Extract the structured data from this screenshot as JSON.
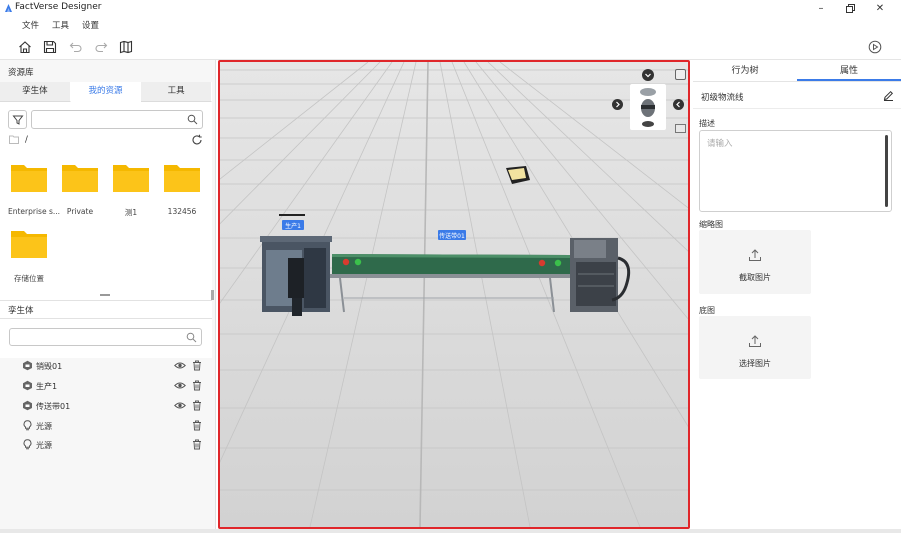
{
  "app": {
    "title": "FactVerse Designer"
  },
  "menu": [
    "文件",
    "工具",
    "设置"
  ],
  "left": {
    "library_title": "资源库",
    "tabs": [
      "孪生体",
      "我的资源",
      "工具"
    ],
    "active_tab": 1,
    "path": "/",
    "search_placeholder": "",
    "folders": [
      "Enterprise s...",
      "Private",
      "测1",
      "132456",
      "存储位置"
    ],
    "twin_section_title": "孪生体",
    "twin_search_placeholder": "",
    "twins": [
      {
        "name": "销毁01",
        "type": "twin",
        "visible": true
      },
      {
        "name": "生产1",
        "type": "twin",
        "visible": true
      },
      {
        "name": "传送带01",
        "type": "twin",
        "visible": true
      },
      {
        "name": "光源",
        "type": "light",
        "visible": false
      },
      {
        "name": "光源",
        "type": "light",
        "visible": false
      }
    ]
  },
  "scene": {
    "labels": {
      "producer": "生产1",
      "conveyor": "传送带01"
    },
    "accent": "#3b7be8",
    "selection_border": "#e0262a"
  },
  "right": {
    "tabs": [
      "行为树",
      "属性"
    ],
    "active_tab": 1,
    "object_name": "初级物流线",
    "description_label": "描述",
    "description_placeholder": "请输入",
    "thumbnail_label": "缩略图",
    "thumbnail_action": "截取图片",
    "base_label": "底图",
    "base_action": "选择图片"
  }
}
